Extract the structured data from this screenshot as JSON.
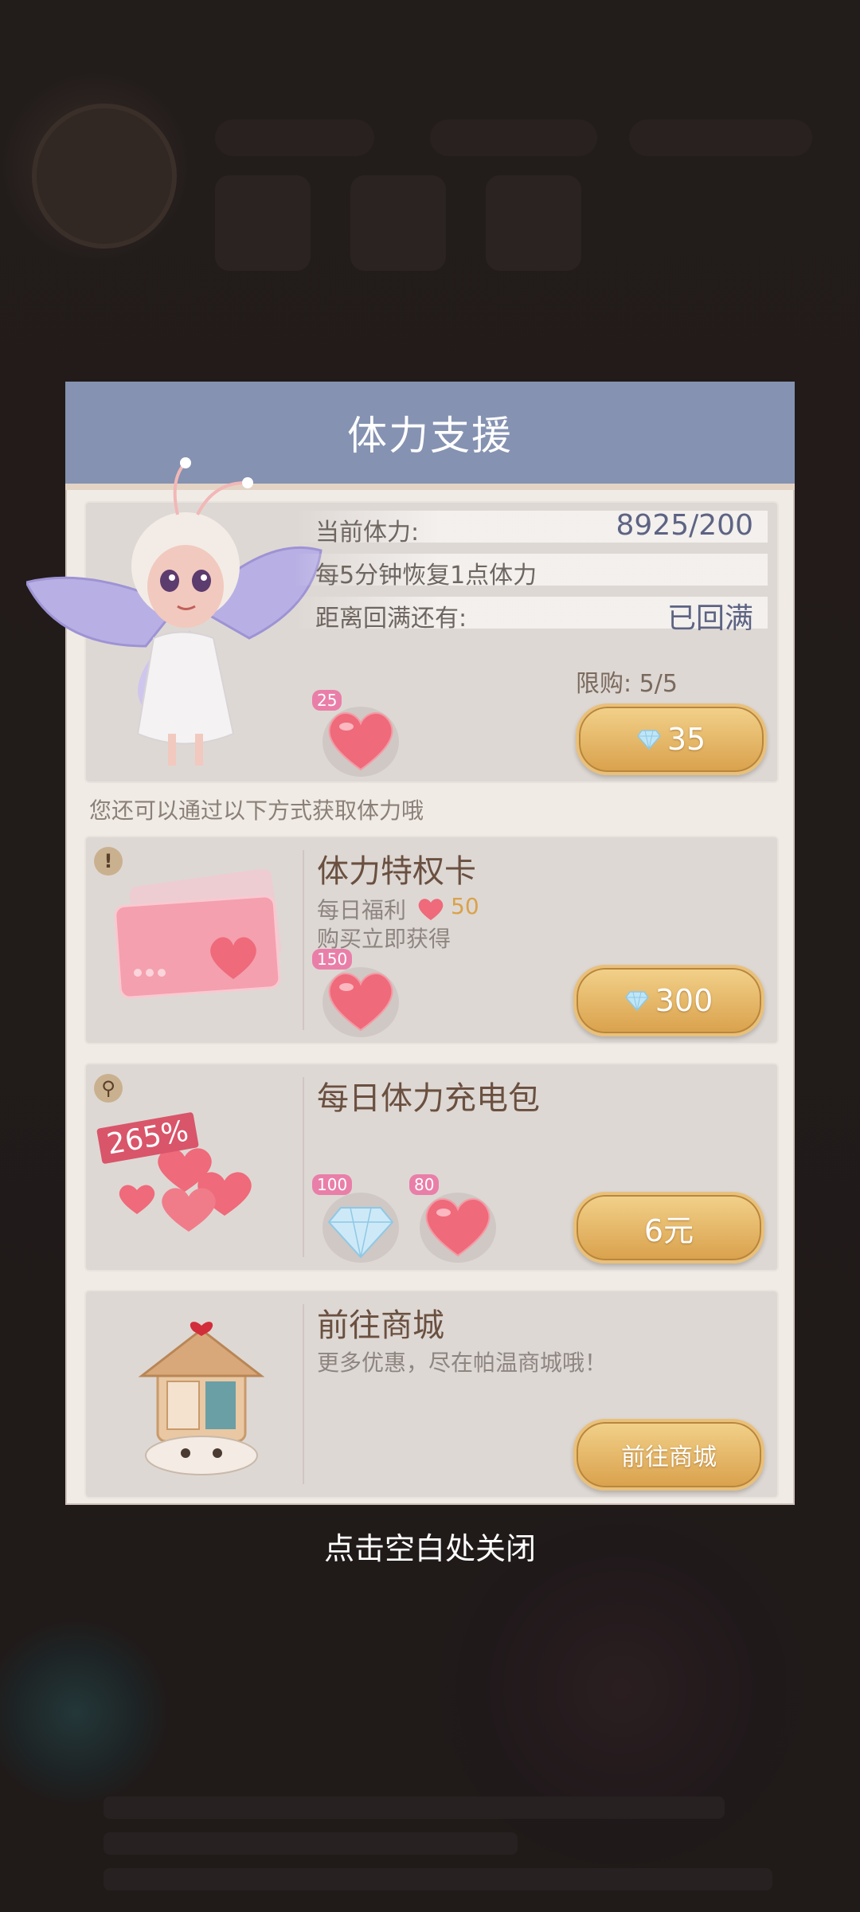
{
  "dialog": {
    "title": "体力支援",
    "stamina": {
      "current_label": "当前体力:",
      "current_value": "8925/200",
      "recover_text": "每5分钟恢复1点体力",
      "full_label": "距离回满还有:",
      "full_value": "已回满",
      "limit_text": "限购: 5/5",
      "heart_count": "25",
      "buy_price": "35"
    },
    "hint": "您还可以通过以下方式获取体力哦",
    "privilege_card": {
      "title": "体力特权卡",
      "daily_label": "每日福利",
      "daily_value": "50",
      "sub": "购买立即获得",
      "heart_count": "150",
      "price": "300"
    },
    "daily_pack": {
      "title": "每日体力充电包",
      "discount": "265%",
      "diamond_count": "100",
      "heart_count": "80",
      "price": "6元"
    },
    "shop": {
      "title": "前往商城",
      "sub": "更多优惠，尽在帕温商城哦！",
      "button": "前往商城"
    }
  },
  "close_hint": "点击空白处关闭"
}
